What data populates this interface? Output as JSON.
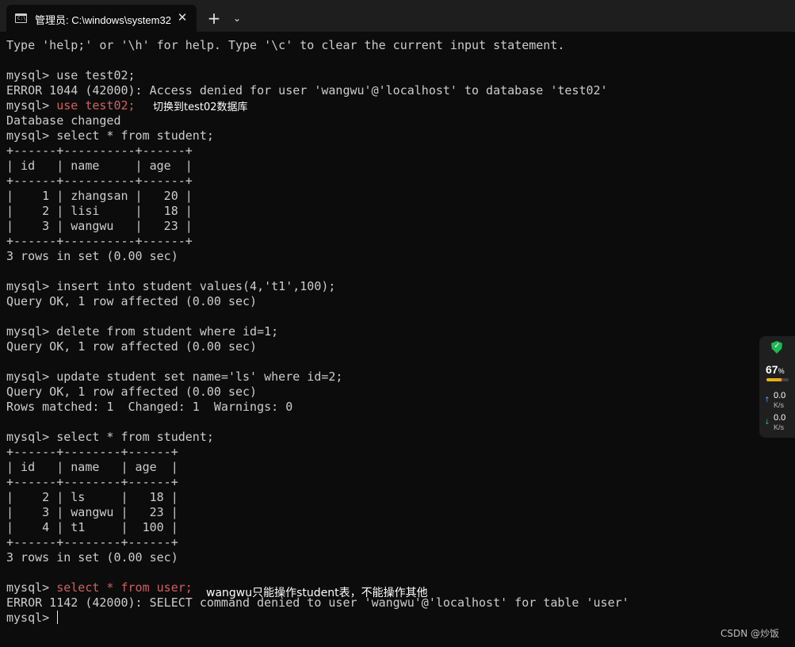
{
  "window": {
    "tab_title": "管理员: C:\\windows\\system32",
    "tab_icon_text": "C:\\",
    "close_glyph": "✕",
    "new_tab_glyph": "+",
    "dropdown_glyph": "⌄"
  },
  "terminal": {
    "lines": [
      "Type 'help;' or '\\h' for help. Type '\\c' to clear the current input statement.",
      "",
      "mysql> use test02;",
      "ERROR 1044 (42000): Access denied for user 'wangwu'@'localhost' to database 'test02'",
      "use test02;",
      "Database changed",
      "mysql> select * from student;",
      "+------+----------+------+",
      "| id   | name     | age  |",
      "+------+----------+------+",
      "|    1 | zhangsan |   20 |",
      "|    2 | lisi     |   18 |",
      "|    3 | wangwu   |   23 |",
      "+------+----------+------+",
      "3 rows in set (0.00 sec)",
      "",
      "mysql> insert into student values(4,'t1',100);",
      "Query OK, 1 row affected (0.00 sec)",
      "",
      "mysql> delete from student where id=1;",
      "Query OK, 1 row affected (0.00 sec)",
      "",
      "mysql> update student set name='ls' where id=2;",
      "Query OK, 1 row affected (0.00 sec)",
      "Rows matched: 1  Changed: 1  Warnings: 0",
      "",
      "mysql> select * from student;",
      "+------+--------+------+",
      "| id   | name   | age  |",
      "+------+--------+------+",
      "|    2 | ls     |   18 |",
      "|    3 | wangwu |   23 |",
      "|    4 | t1     |  100 |",
      "+------+--------+------+",
      "3 rows in set (0.00 sec)",
      "",
      "select * from user;",
      "ERROR 1142 (42000): SELECT command denied to user 'wangwu'@'localhost' for table 'user'",
      "mysql> "
    ],
    "prompt": "mysql> ",
    "highlight_color": "#d06060"
  },
  "annotations": {
    "switch_db": "切换到test02数据库",
    "permission_note": "wangwu只能操作student表，不能操作其他"
  },
  "widget": {
    "percent_value": "67",
    "percent_unit": "%",
    "percent_fill": 0.67,
    "upload_value": "0.0",
    "upload_unit": "K/s",
    "download_value": "0.0",
    "download_unit": "K/s",
    "shield_icon": "shield-check-icon"
  },
  "watermark": "CSDN @炒饭"
}
